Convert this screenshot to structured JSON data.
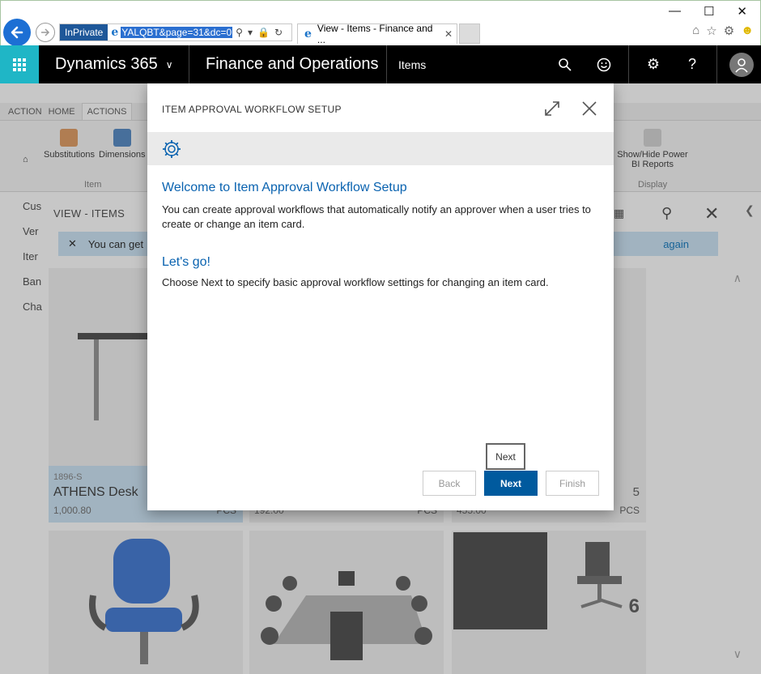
{
  "browser": {
    "inprivate": "InPrivate",
    "url": "YALQBT&page=31&dc=0",
    "tab_title": "View - Items - Finance and ..."
  },
  "navbar": {
    "brand": "Dynamics 365",
    "module": "Finance and Operations",
    "page": "Items",
    "help": "?"
  },
  "background": {
    "tabs": [
      "ACTION",
      "HOME",
      "ACTIONS"
    ],
    "ribbon": {
      "substitutions": "Substitutions",
      "dimensions": "Dimensions",
      "item_group": "Item",
      "power_bi": "Show/Hide Power BI Reports",
      "display_group": "Display"
    },
    "left_nav": [
      "Cus",
      "Ver",
      "Iter",
      "Ban",
      "Cha"
    ],
    "view_title": "VIEW - ITEMS",
    "info_text": "You can get",
    "info_again": "again",
    "tile1": {
      "id": "1896-S",
      "name": "ATHENS Desk",
      "price": "1,000.80"
    },
    "tile2_price": "192.00",
    "tile3_price": "455.00",
    "tile3_qty": "5",
    "pcs": "PCS",
    "tile6_qty": "6"
  },
  "dialog": {
    "title": "ITEM APPROVAL WORKFLOW SETUP",
    "welcome_heading": "Welcome to Item Approval Workflow Setup",
    "welcome_text": "You can create approval workflows that automatically notify an approver when a user tries to create or change an item card.",
    "letsgo_heading": "Let's go!",
    "letsgo_text": "Choose Next to specify basic approval workflow settings for changing an item card.",
    "tooltip": "Next",
    "back_label": "Back",
    "next_label": "Next",
    "finish_label": "Finish"
  },
  "colors": {
    "accent": "#005a9e",
    "waffle": "#1fb6c6",
    "heading": "#0a63b0"
  }
}
